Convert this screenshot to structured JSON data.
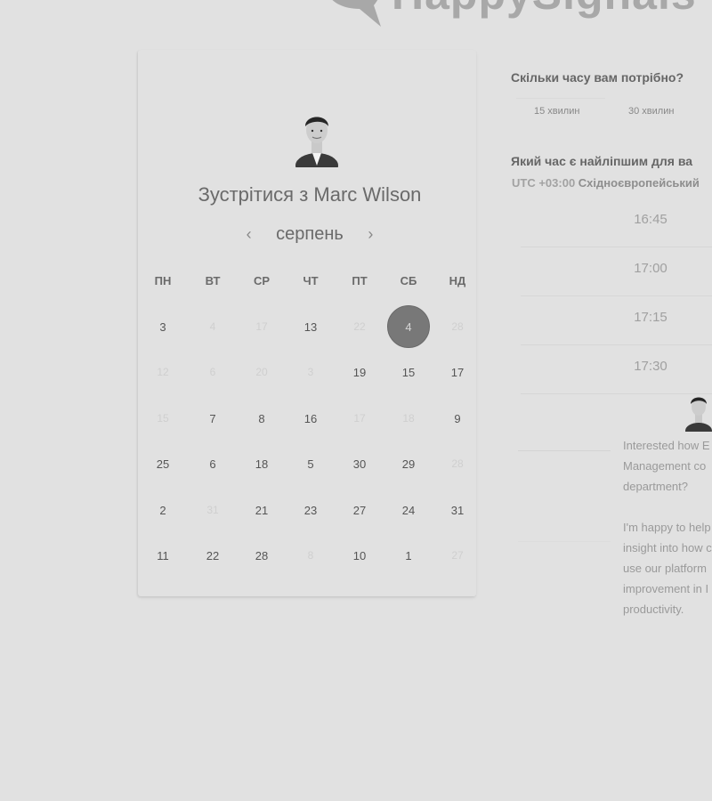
{
  "brand": {
    "logo_text": "HappySignals"
  },
  "calendar": {
    "title_prefix": "Зустрітися з",
    "host_name": "Marc Wilson",
    "month": "серпень",
    "prev_icon": "chevron-left-icon",
    "next_icon": "chevron-right-icon",
    "weekdays": [
      "ПН",
      "ВТ",
      "СР",
      "ЧТ",
      "ПТ",
      "СБ",
      "НД"
    ],
    "weeks": [
      [
        {
          "d": "3",
          "a": true
        },
        {
          "d": "4",
          "a": false
        },
        {
          "d": "17",
          "a": false
        },
        {
          "d": "13",
          "a": true
        },
        {
          "d": "22",
          "a": false
        },
        {
          "d": "4",
          "a": true,
          "sel": true
        },
        {
          "d": "28",
          "a": false
        }
      ],
      [
        {
          "d": "12",
          "a": false
        },
        {
          "d": "6",
          "a": false
        },
        {
          "d": "20",
          "a": false
        },
        {
          "d": "3",
          "a": false
        },
        {
          "d": "19",
          "a": true
        },
        {
          "d": "15",
          "a": true
        },
        {
          "d": "17",
          "a": true
        }
      ],
      [
        {
          "d": "15",
          "a": false
        },
        {
          "d": "7",
          "a": true
        },
        {
          "d": "8",
          "a": true
        },
        {
          "d": "16",
          "a": true
        },
        {
          "d": "17",
          "a": false
        },
        {
          "d": "18",
          "a": false
        },
        {
          "d": "9",
          "a": true
        }
      ],
      [
        {
          "d": "25",
          "a": true
        },
        {
          "d": "6",
          "a": true
        },
        {
          "d": "18",
          "a": true
        },
        {
          "d": "5",
          "a": true
        },
        {
          "d": "30",
          "a": true
        },
        {
          "d": "29",
          "a": true
        },
        {
          "d": "28",
          "a": false
        }
      ],
      [
        {
          "d": "2",
          "a": true
        },
        {
          "d": "31",
          "a": false
        },
        {
          "d": "21",
          "a": true
        },
        {
          "d": "23",
          "a": true
        },
        {
          "d": "27",
          "a": true
        },
        {
          "d": "24",
          "a": true
        },
        {
          "d": "31",
          "a": true
        }
      ],
      [
        {
          "d": "11",
          "a": true
        },
        {
          "d": "22",
          "a": true
        },
        {
          "d": "28",
          "a": true
        },
        {
          "d": "8",
          "a": false
        },
        {
          "d": "10",
          "a": true
        },
        {
          "d": "1",
          "a": true
        },
        {
          "d": "27",
          "a": false
        }
      ]
    ]
  },
  "booking": {
    "duration_question": "Скільки часу вам потрібно?",
    "durations": [
      "15 хвилин",
      "30 хвилин"
    ],
    "time_question": "Який час є найліпшим для ва",
    "timezone_offset": "UTC +03:00",
    "timezone_name": "Східноєвропейський",
    "slots": [
      "16:45",
      "17:00",
      "17:15",
      "17:30"
    ]
  },
  "message": {
    "line1": "Interested how E\nManagement co\ndepartment?",
    "line2": "I'm happy to help\ninsight into how c\nuse our platform\nimprovement in I\nproductivity."
  },
  "colors": {
    "selected_day": "#787878",
    "background": "#e1e1e1"
  }
}
